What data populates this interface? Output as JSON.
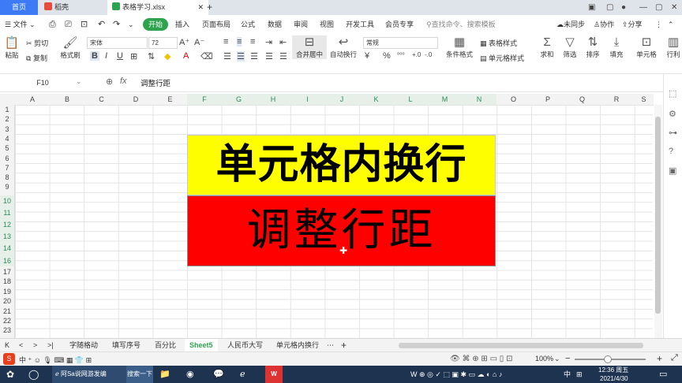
{
  "tabs": {
    "home": "首页",
    "daoke": "稻壳",
    "file": "表格学习.xlsx"
  },
  "menu": {
    "file": "文件",
    "start": "开始",
    "insert": "插入",
    "layout": "页面布局",
    "formula": "公式",
    "data": "数据",
    "review": "审阅",
    "view": "视图",
    "dev": "开发工具",
    "vip": "会员专享",
    "search_placeholder": "查找命令、搜索模板",
    "unsynced": "未同步",
    "collab": "协作",
    "share": "分享"
  },
  "ribbon": {
    "cut": "剪切",
    "copy": "复制",
    "format_painter": "格式刷",
    "paste": "粘贴",
    "font_name": "宋体",
    "font_size": "72",
    "merge_center": "合并居中",
    "wrap": "自动换行",
    "number_format": "常规",
    "cond_format": "条件格式",
    "table_style": "表格样式",
    "cell_style": "单元格样式",
    "sum": "求和",
    "filter": "筛选",
    "sort": "排序",
    "fill": "填充",
    "cell": "单元格",
    "row_col": "行利"
  },
  "formula_bar": {
    "name_box": "F10",
    "fx": "fx",
    "content": "调整行距"
  },
  "columns": [
    "A",
    "B",
    "C",
    "D",
    "E",
    "F",
    "G",
    "H",
    "I",
    "J",
    "K",
    "L",
    "M",
    "N",
    "O",
    "P",
    "Q",
    "R",
    "S"
  ],
  "rows": [
    "1",
    "2",
    "3",
    "4",
    "5",
    "6",
    "7",
    "8",
    "9",
    "10",
    "11",
    "12",
    "13",
    "14",
    "15",
    "16",
    "17",
    "18",
    "19",
    "20",
    "21",
    "22",
    "23"
  ],
  "cells": {
    "yellow_text": "单元格内换行",
    "red_text": "调整行距",
    "yellow_color": "#fefe00",
    "red_color": "#ff0000"
  },
  "sheets": [
    "字随格动",
    "填写序号",
    "百分比",
    "Sheet5",
    "人民币大写",
    "单元格内换行"
  ],
  "active_sheet": "Sheet5",
  "status": {
    "zoom": "100%"
  },
  "taskbar": {
    "sougou_item": "阿Sa说网游发编",
    "search": "搜索一下",
    "time": "12:36 周五",
    "date": "2021/4/30",
    "ime": "中"
  }
}
